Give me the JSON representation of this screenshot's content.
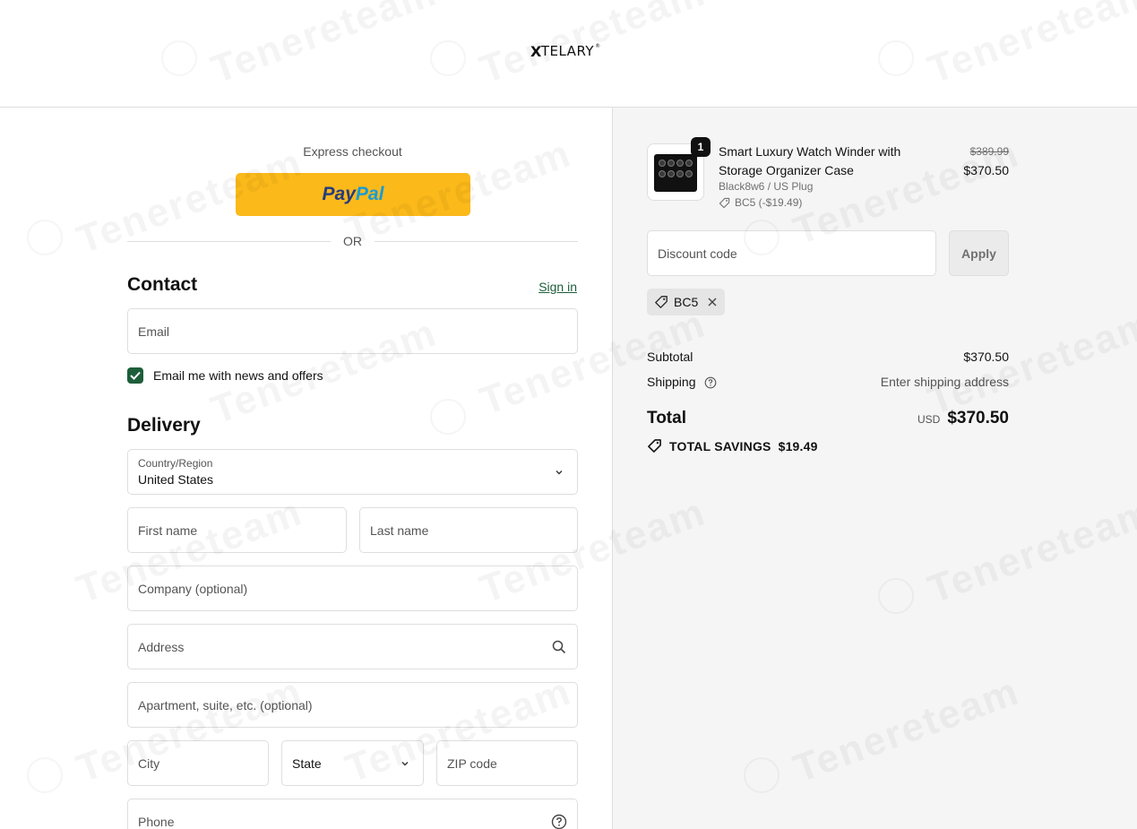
{
  "brand": {
    "logo_text": "TELARY",
    "logo_mark": "X",
    "registered": "®"
  },
  "checkout": {
    "express_label": "Express checkout",
    "paypal_pay": "Pay",
    "paypal_pal": "Pal",
    "or_label": "OR"
  },
  "contact": {
    "title": "Contact",
    "sign_in": "Sign in",
    "email_placeholder": "Email",
    "newsletter_label": "Email me with news and offers",
    "newsletter_checked": true
  },
  "delivery": {
    "title": "Delivery",
    "country_label": "Country/Region",
    "country_value": "United States",
    "first_name": "First name",
    "last_name": "Last name",
    "company": "Company (optional)",
    "address": "Address",
    "apartment": "Apartment, suite, etc. (optional)",
    "city": "City",
    "state": "State",
    "zip": "ZIP code",
    "phone": "Phone"
  },
  "order": {
    "quantity": "1",
    "product_name": "Smart Luxury Watch Winder with Storage Organizer Case",
    "variant": "Black8w6 / US Plug",
    "discount_applied": "BC5 (-$19.49)",
    "price_original": "$389.99",
    "price_current": "$370.50",
    "discount_placeholder": "Discount code",
    "apply_label": "Apply",
    "code_chip": "BC5",
    "subtotal_label": "Subtotal",
    "subtotal_value": "$370.50",
    "shipping_label": "Shipping",
    "shipping_value": "Enter shipping address",
    "total_label": "Total",
    "currency": "USD",
    "total_value": "$370.50",
    "savings_label": "TOTAL SAVINGS",
    "savings_value": "$19.49"
  },
  "watermark": {
    "text": "Tenereteam"
  },
  "colors": {
    "accent": "#1d5e3a",
    "paypal_yellow": "#fbb91a",
    "paypal_navy": "#253b80",
    "paypal_blue": "#179bd7"
  }
}
